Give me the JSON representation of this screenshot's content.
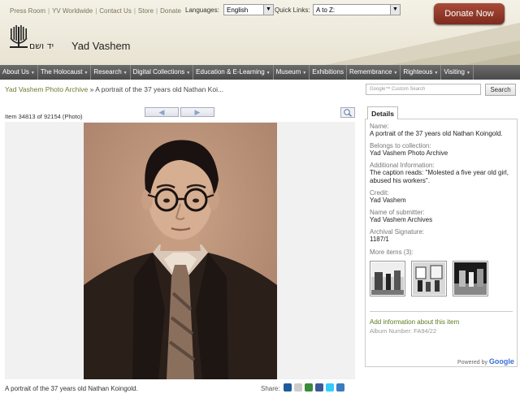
{
  "header": {
    "top_links": [
      "Press Room",
      "YV Worldwide",
      "Contact Us",
      "Store",
      "Donate"
    ],
    "languages_label": "Languages:",
    "language_value": "English",
    "quick_links_label": "Quick Links:",
    "quick_links_value": "A to Z:",
    "donate_label": "Donate Now",
    "logo_hebrew": "יד ושם",
    "logo_name": "Yad Vashem"
  },
  "nav": {
    "items": [
      {
        "label": "About Us",
        "dropdown": true
      },
      {
        "label": "The Holocaust",
        "dropdown": true
      },
      {
        "label": "Research",
        "dropdown": true
      },
      {
        "label": "Digital Collections",
        "dropdown": true
      },
      {
        "label": "Education & E-Learning",
        "dropdown": true
      },
      {
        "label": "Museum",
        "dropdown": true
      },
      {
        "label": "Exhibitions",
        "dropdown": false
      },
      {
        "label": "Remembrance",
        "dropdown": true
      },
      {
        "label": "Righteous",
        "dropdown": true
      },
      {
        "label": "Visiting",
        "dropdown": true
      }
    ]
  },
  "breadcrumb": {
    "root": "Yad Vashem Photo Archive",
    "separator": "»",
    "current": "A portrait of the 37 years old Nathan Koi..."
  },
  "search": {
    "placeholder": "Google™ Custom Search",
    "button_label": "Search"
  },
  "viewer": {
    "item_counter": "Item 34813 of 92154 (Photo)",
    "prev_label": "◀",
    "next_label": "▶",
    "caption": "A portrait of the 37 years old Nathan Koingold.",
    "share_label": "Share:",
    "share_icons": [
      {
        "name": "digg-icon",
        "color": "#1d5c9c"
      },
      {
        "name": "delicious-icon",
        "color": "#cccccc"
      },
      {
        "name": "google-bookmarks-icon",
        "color": "#3a8c3a"
      },
      {
        "name": "facebook-icon",
        "color": "#3b5998"
      },
      {
        "name": "twitter-icon",
        "color": "#33ccff"
      },
      {
        "name": "email-icon",
        "color": "#3b7bbf"
      }
    ]
  },
  "details": {
    "tab_label": "Details",
    "fields": [
      {
        "label": "Name:",
        "value": "A portrait of the 37 years old Nathan Koingold."
      },
      {
        "label": "Belongs to collection:",
        "value": "Yad Vashem Photo Archive"
      },
      {
        "label": "Additional Information:",
        "value": "The caption reads: \"Molested a five year old girl, abused his workers\"."
      },
      {
        "label": "Credit:",
        "value": "Yad Vashem"
      },
      {
        "label": "Name of submitter:",
        "value": "Yad Vashem Archives"
      },
      {
        "label": "Archival Signature:",
        "value": "1187/1"
      }
    ],
    "more_items_label": "More items (3):",
    "add_info_label": "Add information about this item",
    "album_number": "Album Number: FA94/22",
    "powered_by": "Powered by",
    "powered_brand": "Google"
  },
  "colors": {
    "nav_bg": "#555555",
    "link_green": "#6b7a2e",
    "donate_red": "#8f3a2a",
    "photo_sepia": "#b58a6e"
  }
}
